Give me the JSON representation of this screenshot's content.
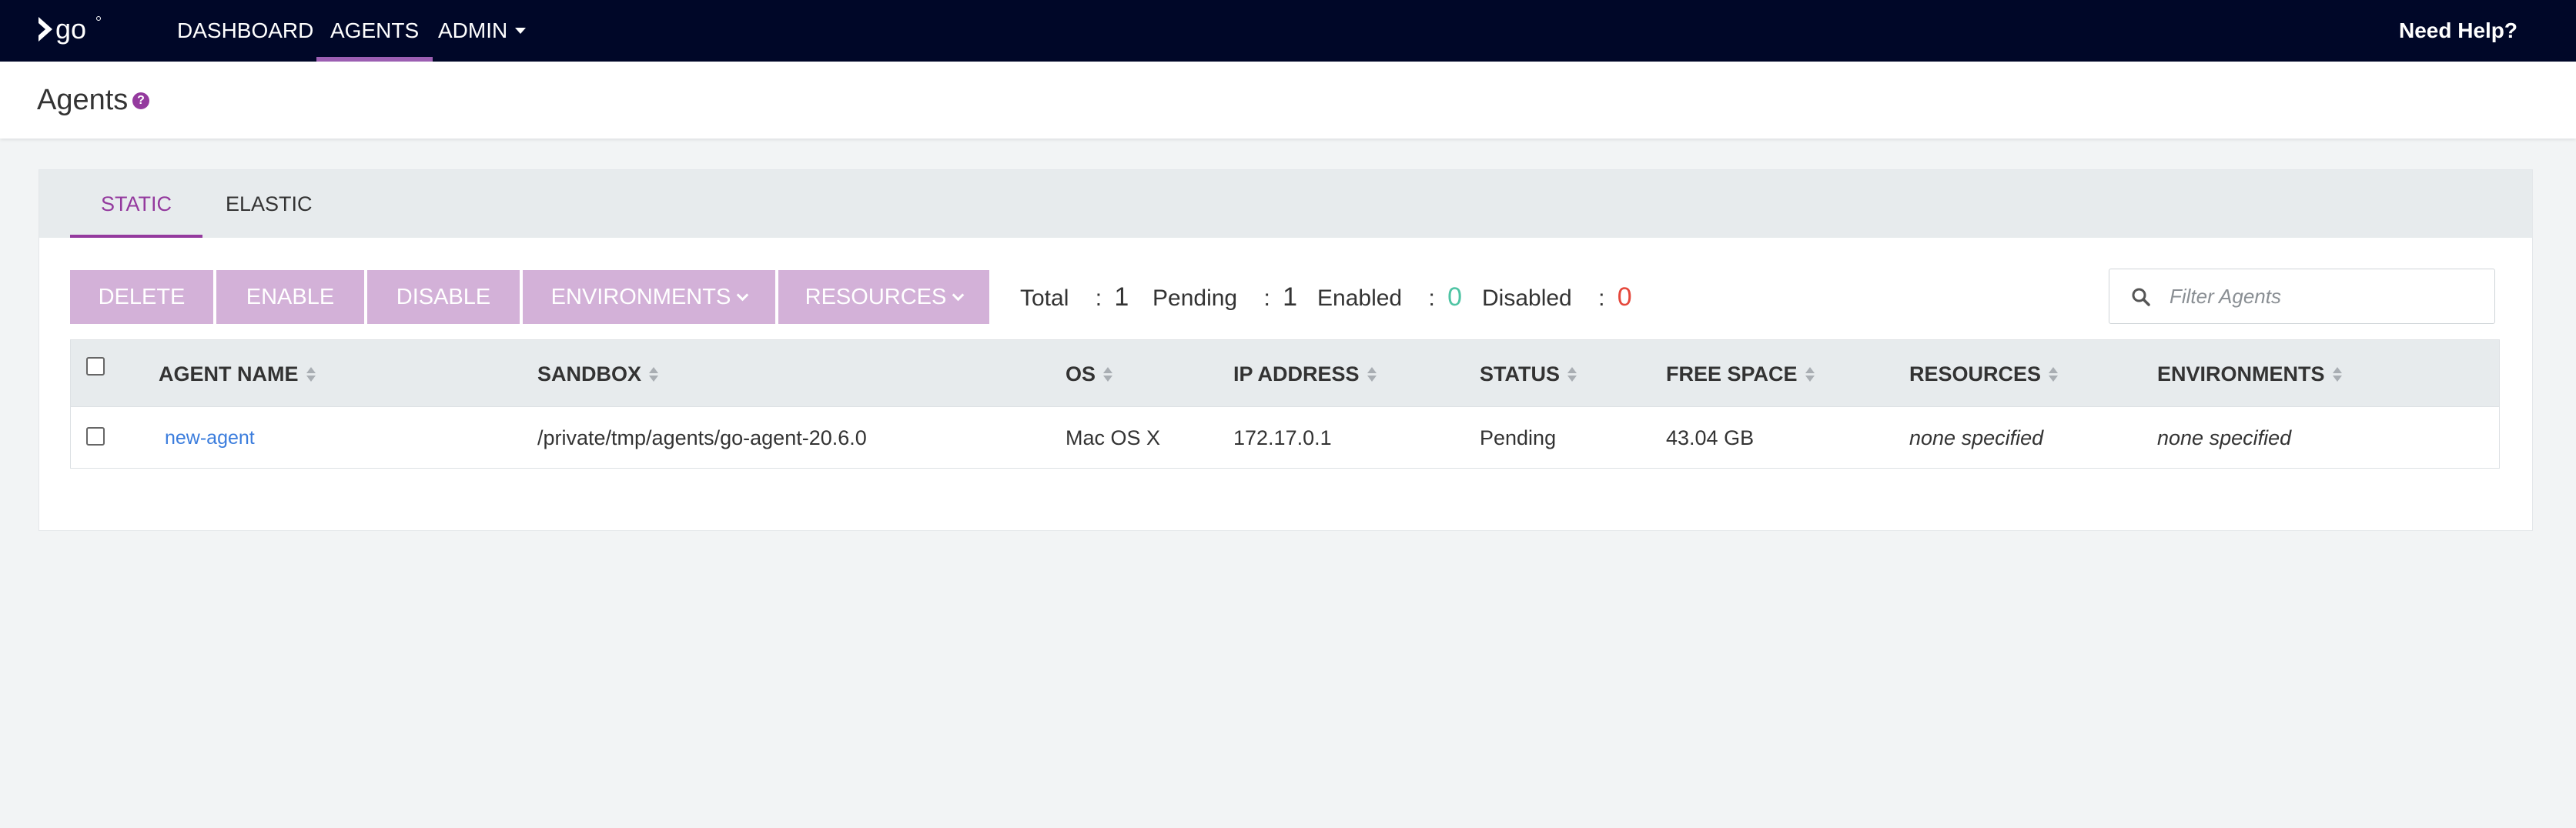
{
  "nav": {
    "logo_text": "go",
    "items": [
      {
        "label": "DASHBOARD"
      },
      {
        "label": "AGENTS"
      },
      {
        "label": "ADMIN"
      }
    ],
    "help_label": "Need Help?"
  },
  "page": {
    "title": "Agents",
    "help_icon_glyph": "?"
  },
  "tabs": [
    {
      "label": "STATIC",
      "active": true
    },
    {
      "label": "ELASTIC",
      "active": false
    }
  ],
  "actions": {
    "delete_label": "DELETE",
    "enable_label": "ENABLE",
    "disable_label": "DISABLE",
    "environments_label": "ENVIRONMENTS",
    "resources_label": "RESOURCES"
  },
  "counts": {
    "total_label": "Total",
    "total_value": "1",
    "pending_label": "Pending",
    "pending_value": "1",
    "enabled_label": "Enabled",
    "enabled_value": "0",
    "disabled_label": "Disabled",
    "disabled_value": "0",
    "separator": ":"
  },
  "filter": {
    "placeholder": "Filter Agents",
    "value": ""
  },
  "table": {
    "headers": [
      "AGENT NAME",
      "SANDBOX",
      "OS",
      "IP ADDRESS",
      "STATUS",
      "FREE SPACE",
      "RESOURCES",
      "ENVIRONMENTS"
    ],
    "rows": [
      {
        "agent_name": "new-agent",
        "sandbox": "/private/tmp/agents/go-agent-20.6.0",
        "os": "Mac OS X",
        "ip_address": "172.17.0.1",
        "status": "Pending",
        "free_space": "43.04 GB",
        "resources": "none specified",
        "environments": "none specified"
      }
    ]
  },
  "colors": {
    "nav_bg": "#000728",
    "accent": "#943a9e",
    "button_bg": "#d3b1d8",
    "enabled_count": "#4fc4a4",
    "disabled_count": "#e5473b",
    "link": "#3b7ddd"
  }
}
